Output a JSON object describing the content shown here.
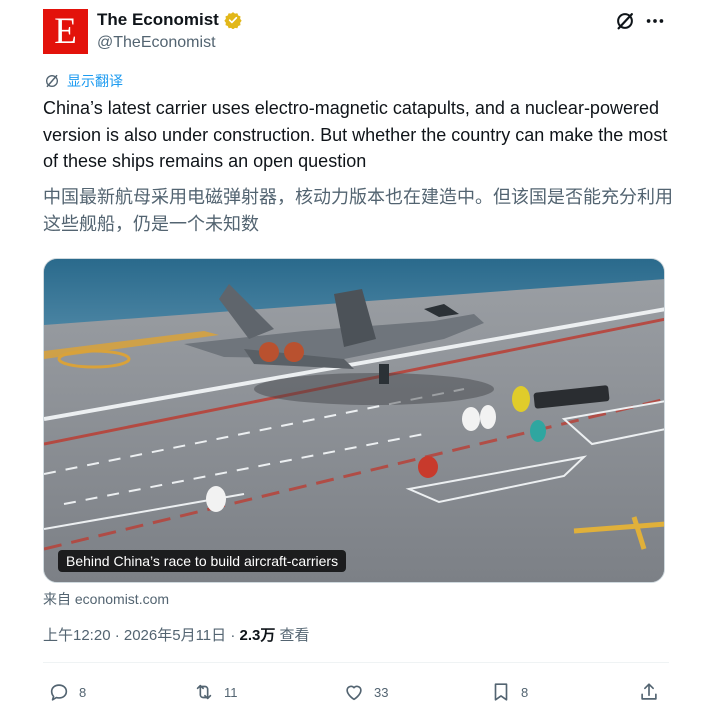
{
  "account": {
    "display_name": "The Economist",
    "handle": "@TheEconomist",
    "logo_letter": "E",
    "brand_color": "#e3120b",
    "verified_color": "#e2b719"
  },
  "header_icons": [
    "grok-icon",
    "more-icon"
  ],
  "translate_label": "显示翻译",
  "tweet": {
    "text": "China’s latest carrier uses electro-magnetic catapults, and a nuclear-powered version is also under construction. But whether the country can make the most of these ships remains an open question",
    "translation": "中国最新航母采用电磁弹射器，核动力版本也在建造中。但该国是否能充分利用这些舰船，仍是一个未知数"
  },
  "card": {
    "caption": "Behind China’s race to build aircraft-carriers",
    "source": "来自 economist.com"
  },
  "meta": {
    "time": "上午12:20 · 2026年5月11日 · ",
    "views": "2.3万",
    "views_label": " 查看"
  },
  "actions": {
    "replies": "8",
    "retweets": "11",
    "likes": "33",
    "bookmarks": "8"
  },
  "colors": {
    "link": "#1d9bf0",
    "muted": "#536471",
    "text": "#0f1419"
  }
}
